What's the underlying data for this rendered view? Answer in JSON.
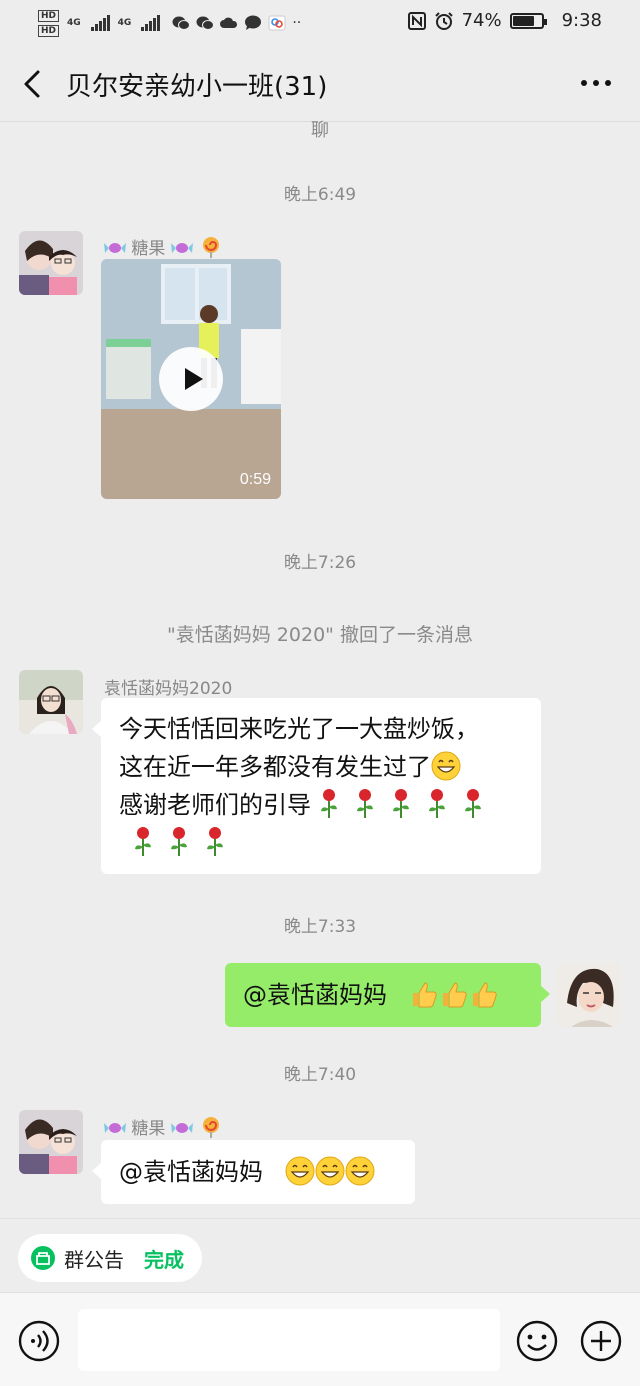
{
  "status_bar": {
    "hd1": "HD",
    "hd2": "HD",
    "net1": "4G",
    "net2": "4G",
    "battery_text": "74%",
    "time": "9:38"
  },
  "header": {
    "title": "贝尔安亲幼小一班(31)"
  },
  "chat": {
    "partial_text": "聊",
    "messages": [
      {
        "time": "晚上6:49",
        "sender_name": "糖果",
        "video_duration": "0:59"
      },
      {
        "time": "晚上7:26",
        "system_text": "\"袁恬菡妈妈 2020\" 撤回了一条消息"
      },
      {
        "sender_name": "袁恬菡妈妈2020",
        "lines": [
          "今天恬恬回来吃光了一大盘炒饭，",
          "这在近一年多都没有发生过了",
          "感谢老师们的引导"
        ]
      },
      {
        "time": "晚上7:33",
        "text": "@袁恬菡妈妈"
      },
      {
        "time": "晚上7:40",
        "sender_name": "糖果",
        "text": "@袁恬菡妈妈"
      }
    ]
  },
  "notice_bar": {
    "label": "群公告",
    "done_label": "完成"
  },
  "colors": {
    "self_bubble": "#95ec69",
    "done_green": "#07c160",
    "background": "#ededed"
  }
}
